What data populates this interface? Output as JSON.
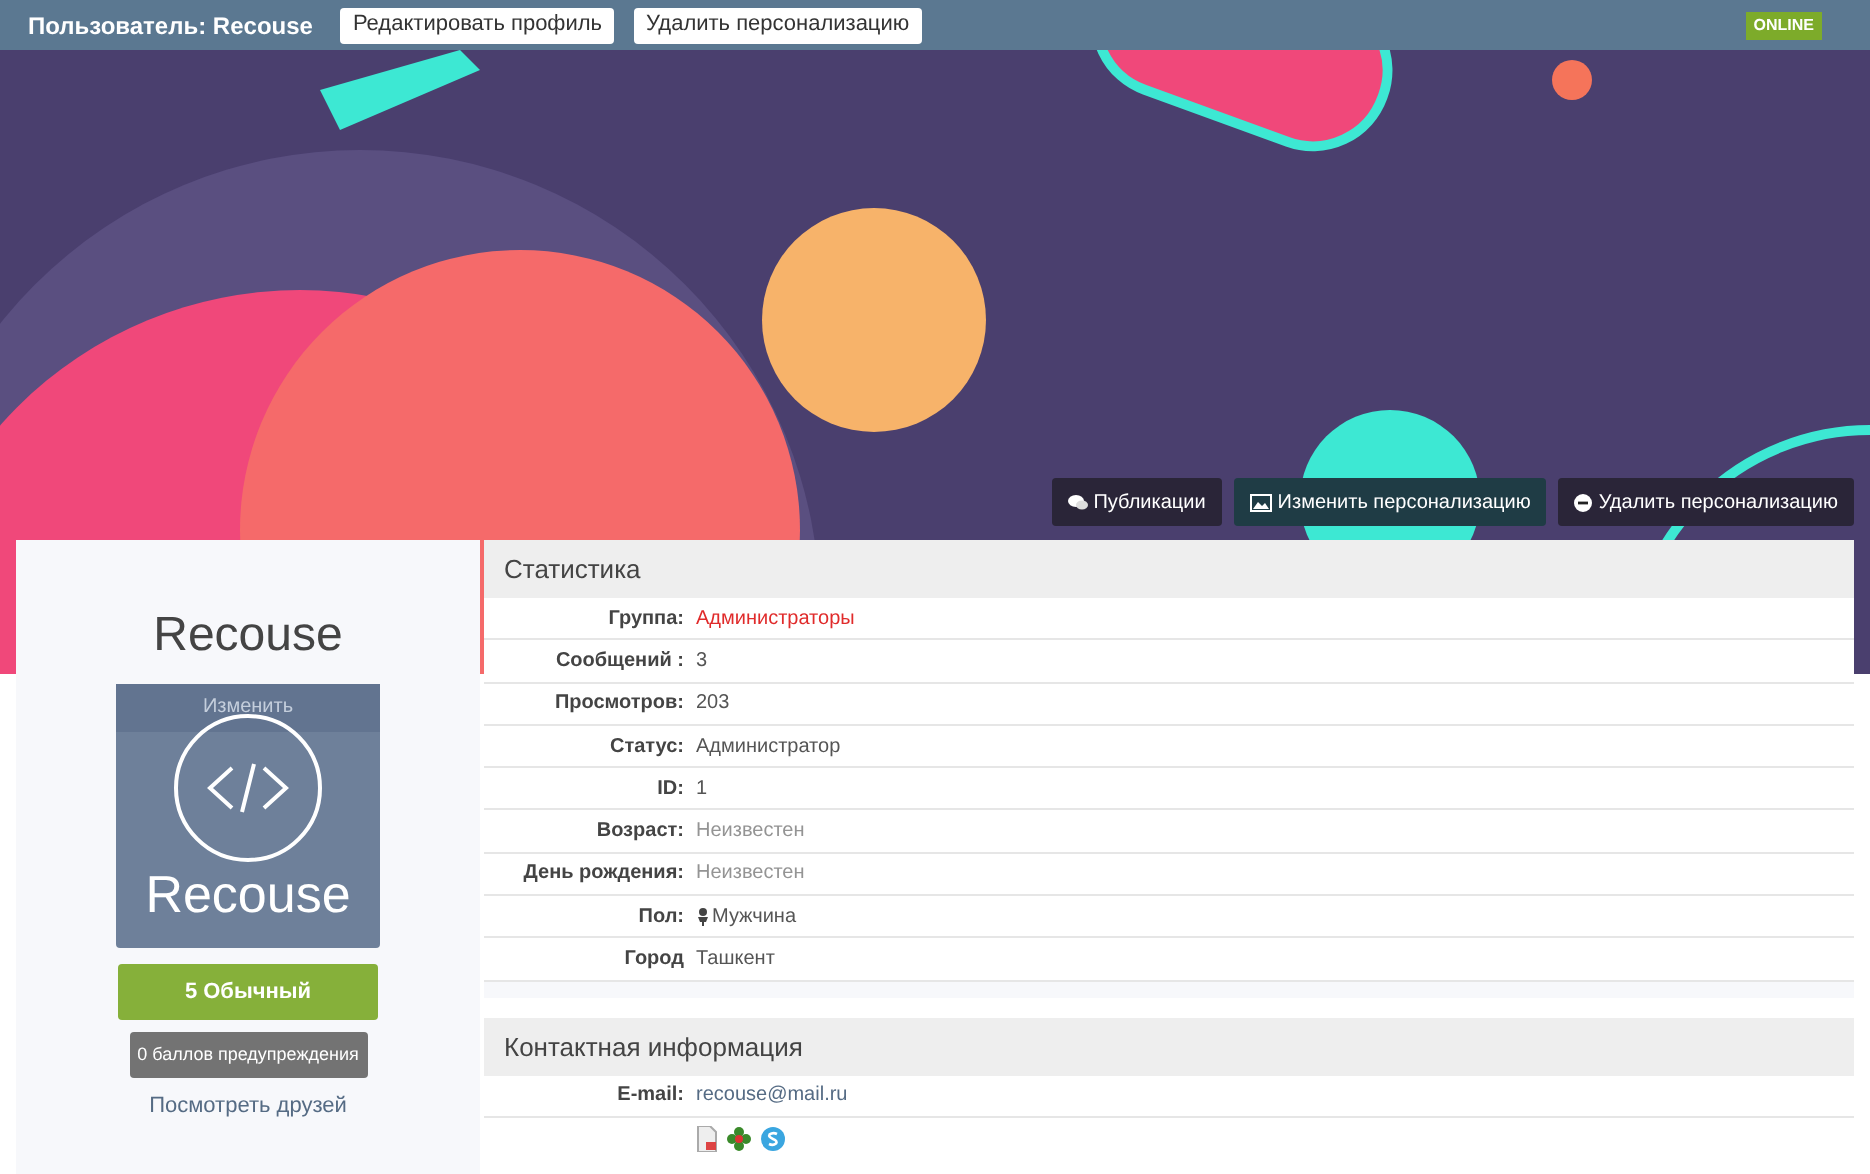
{
  "top_bar": {
    "title": "Пользователь: Recouse",
    "buttons": [
      "Редактировать профиль",
      "Удалить персонализацию"
    ],
    "status_badge": "ONLINE"
  },
  "banner_buttons": [
    {
      "label": "Публикации",
      "kind": "comments"
    },
    {
      "label": "Изменить персонализацию",
      "kind": "image"
    },
    {
      "label": "Удалить персонализацию",
      "kind": "minus"
    }
  ],
  "profile": {
    "name": "Recouse",
    "avatar_overlay": "Изменить",
    "avatar_text": "Recouse",
    "rank": "5 Обычный",
    "warnings": "0 баллов предупреждения",
    "friends_link": "Посмотреть друзей"
  },
  "statistics": {
    "title": "Статистика",
    "rows": [
      {
        "label": "Группа:",
        "value": "Администраторы",
        "kind": "group"
      },
      {
        "label": "Сообщений :",
        "value": "3",
        "kind": "plain"
      },
      {
        "label": "Просмотров:",
        "value": "203",
        "kind": "plain"
      },
      {
        "label": "Статус:",
        "value": "Администратор",
        "kind": "plain"
      },
      {
        "label": "ID:",
        "value": "1",
        "kind": "plain"
      },
      {
        "label": "Возраст:",
        "value": "Неизвестен",
        "kind": "unknown"
      },
      {
        "label": "День рождения:",
        "value": "Неизвестен",
        "kind": "unknown"
      },
      {
        "label": "Пол:",
        "value": "Мужчина",
        "kind": "gender"
      },
      {
        "label": "Город",
        "value": "Ташкент",
        "kind": "plain"
      }
    ]
  },
  "contacts": {
    "title": "Контактная информация",
    "email_label": "E-mail:",
    "email": "recouse@mail.ru"
  }
}
